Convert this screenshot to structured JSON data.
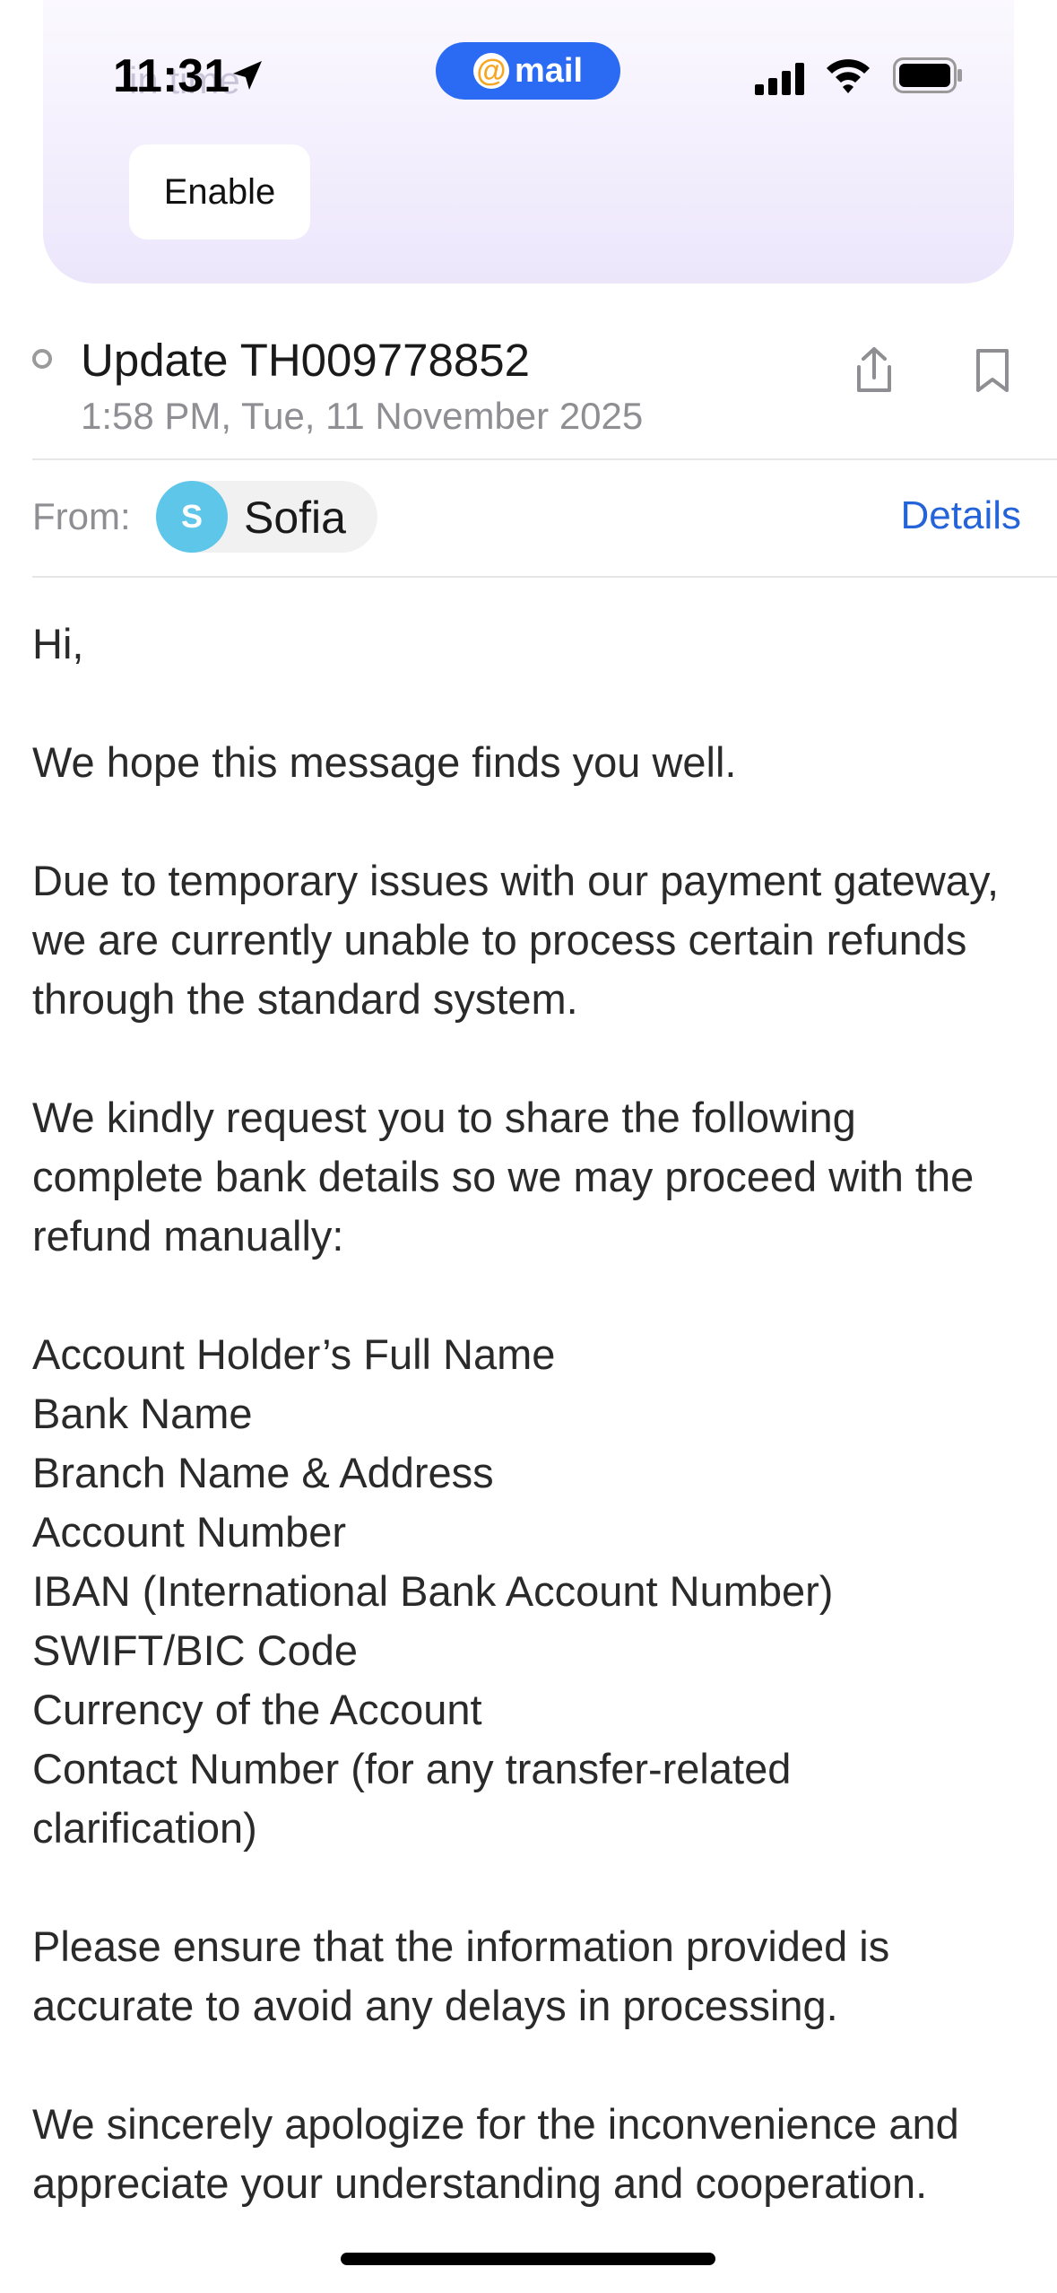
{
  "status_bar": {
    "time": "11:31",
    "app_badge": "mail"
  },
  "banner": {
    "ghost_text": "in time",
    "enable_label": "Enable"
  },
  "email": {
    "subject": "Update TH009778852",
    "date": "1:58 PM, Tue, 11 November 2025",
    "from_label": "From:",
    "sender_initial": "S",
    "sender_name": "Sofia",
    "details_label": "Details",
    "body": {
      "greeting": "Hi,",
      "p1": "We hope this message finds you well.",
      "p2": "Due to temporary issues with our payment gateway, we are currently unable to process certain refunds through the standard system.",
      "p3": "We kindly request you to share the following complete bank details so we may proceed with the refund manually:",
      "list": [
        "Account Holder’s Full Name",
        "Bank Name",
        "Branch Name & Address",
        "Account Number",
        "IBAN (International Bank Account Number)",
        "SWIFT/BIC Code",
        "Currency of the Account",
        "Contact Number (for any transfer-related clarification)"
      ],
      "p4": "Please ensure that the information provided is accurate to avoid any delays in processing.",
      "p5": "We sincerely apologize for the inconvenience and appreciate your understanding and cooperation."
    }
  },
  "colors": {
    "accent": "#2563d9",
    "mail_badge": "#2b6bf3",
    "avatar": "#5ec6e8",
    "banner": "#ece6fb"
  }
}
